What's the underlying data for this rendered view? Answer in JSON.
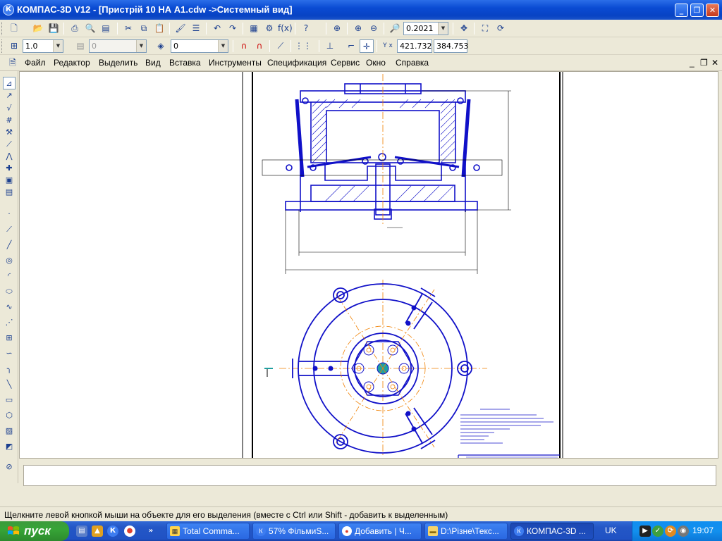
{
  "window": {
    "app_icon": "К",
    "title": "КОМПАС-3D V12 - [Пристрій 10 НА А1.cdw ->Системный вид]",
    "minimize": "_",
    "maximize": "❐",
    "close": "✕"
  },
  "toolbar_top": {
    "zoom_value": "0.2021"
  },
  "toolbar_current": {
    "scale_value": "1.0",
    "style_value": "0",
    "layer_value": "0",
    "coord_x": "421.732",
    "coord_y": "384.753",
    "coord_label": "Y x"
  },
  "menu": {
    "items": [
      {
        "label": "Файл"
      },
      {
        "label": "Редактор"
      },
      {
        "label": "Выделить"
      },
      {
        "label": "Вид"
      },
      {
        "label": "Вставка"
      },
      {
        "label": "Инструменты"
      },
      {
        "label": "Спецификация"
      },
      {
        "label": "Сервис"
      },
      {
        "label": "Окно"
      },
      {
        "label": "Справка"
      }
    ],
    "doc_minimize": "_",
    "doc_restore": "❐",
    "doc_close": "✕"
  },
  "status": {
    "text": "Щелкните левой кнопкой мыши на объекте для его выделения (вместе с Ctrl или Shift - добавить к выделенным)"
  },
  "taskbar": {
    "start_label": "пуск",
    "tasks": [
      {
        "label": "Total Comma...",
        "icon": "total-commander-icon"
      },
      {
        "label": "57% ФільмиS...",
        "icon": "kompas-icon"
      },
      {
        "label": "Добавить | Ч...",
        "icon": "chrome-icon"
      },
      {
        "label": "D:\\Різне\\Текс...",
        "icon": "folder-icon"
      },
      {
        "label": "КОМПАС-3D ...",
        "icon": "kompas-icon"
      }
    ],
    "language": "UK",
    "clock": "19:07"
  },
  "colors": {
    "drawing_blue": "#1010c8",
    "axis_orange": "#f08000",
    "frame_black": "#000000"
  }
}
